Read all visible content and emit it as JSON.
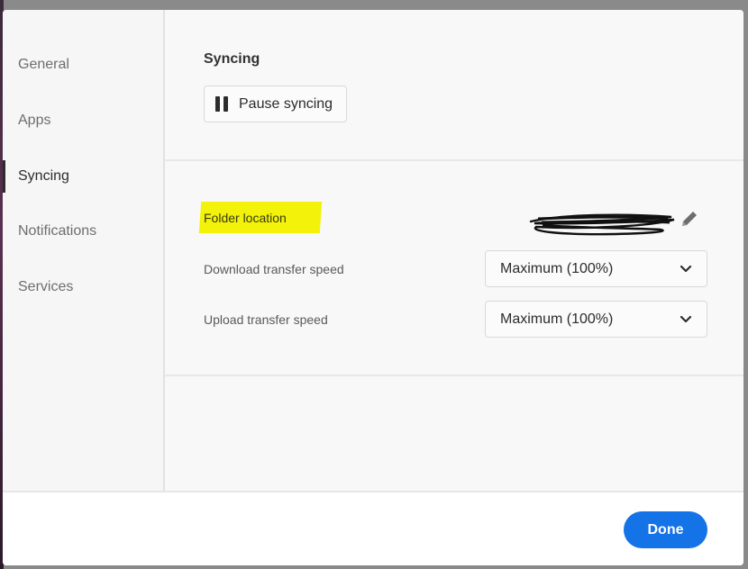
{
  "sidebar": {
    "items": [
      {
        "label": "General",
        "active": false
      },
      {
        "label": "Apps",
        "active": false
      },
      {
        "label": "Syncing",
        "active": true
      },
      {
        "label": "Notifications",
        "active": false
      },
      {
        "label": "Services",
        "active": false
      }
    ]
  },
  "syncing": {
    "title": "Syncing",
    "pause_label": "Pause syncing"
  },
  "settings": {
    "folder_location_label": "Folder location",
    "download_label": "Download transfer speed",
    "download_value": "Maximum (100%)",
    "upload_label": "Upload transfer speed",
    "upload_value": "Maximum (100%)"
  },
  "footer": {
    "done_label": "Done"
  },
  "icons": {
    "pause": "pause-icon",
    "edit": "pencil-icon",
    "dropdown": "chevron-down-icon"
  },
  "colors": {
    "accent": "#1473e6",
    "highlight": "#f2f20a"
  }
}
